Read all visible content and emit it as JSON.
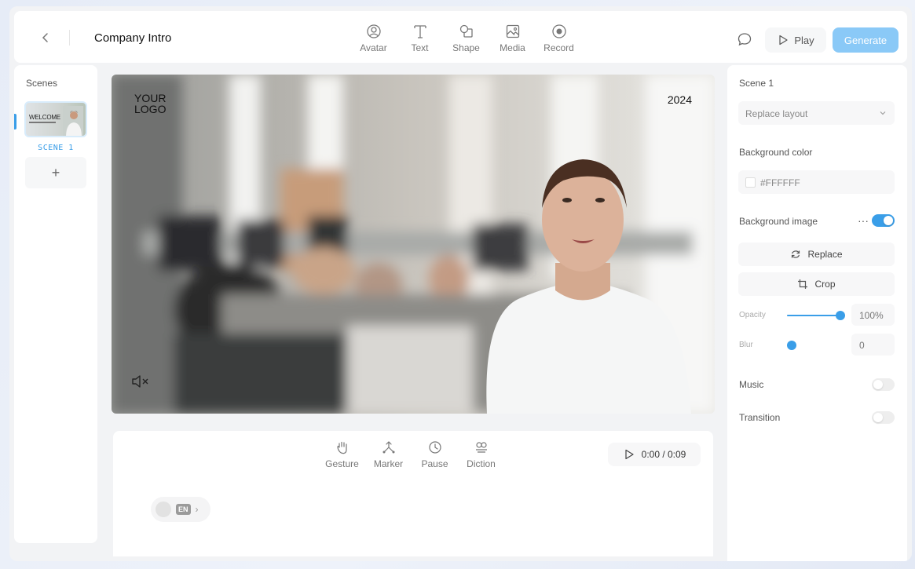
{
  "header": {
    "project_title": "Company Intro",
    "tools": [
      {
        "label": "Avatar",
        "icon": "avatar-icon"
      },
      {
        "label": "Text",
        "icon": "text-icon"
      },
      {
        "label": "Shape",
        "icon": "shape-icon"
      },
      {
        "label": "Media",
        "icon": "media-icon"
      },
      {
        "label": "Record",
        "icon": "record-icon"
      }
    ],
    "play_label": "Play",
    "generate_label": "Generate"
  },
  "scenes": {
    "title": "Scenes",
    "items": [
      {
        "label": "SCENE 1",
        "thumb_text": "WELCOME"
      }
    ]
  },
  "canvas": {
    "logo_text": "YOUR\nLOGO",
    "year": "2024"
  },
  "script": {
    "tools": [
      {
        "label": "Gesture",
        "icon": "gesture-icon"
      },
      {
        "label": "Marker",
        "icon": "marker-icon"
      },
      {
        "label": "Pause",
        "icon": "pause-clock-icon"
      },
      {
        "label": "Diction",
        "icon": "diction-icon"
      }
    ],
    "time": "0:00 / 0:09",
    "language": "EN"
  },
  "properties": {
    "scene_title": "Scene 1",
    "layout_placeholder": "Replace layout",
    "bg_color_label": "Background color",
    "bg_color_value": "#FFFFFF",
    "bg_image_label": "Background image",
    "bg_image_enabled": true,
    "replace_label": "Replace",
    "crop_label": "Crop",
    "opacity_label": "Opacity",
    "opacity_value": "100%",
    "opacity_fraction": 1.0,
    "blur_label": "Blur",
    "blur_value": "0",
    "blur_fraction": 0.0,
    "music_label": "Music",
    "music_enabled": false,
    "transition_label": "Transition",
    "transition_enabled": false
  },
  "colors": {
    "accent": "#3a9ee8",
    "generate_button": "#8ac9f7"
  }
}
